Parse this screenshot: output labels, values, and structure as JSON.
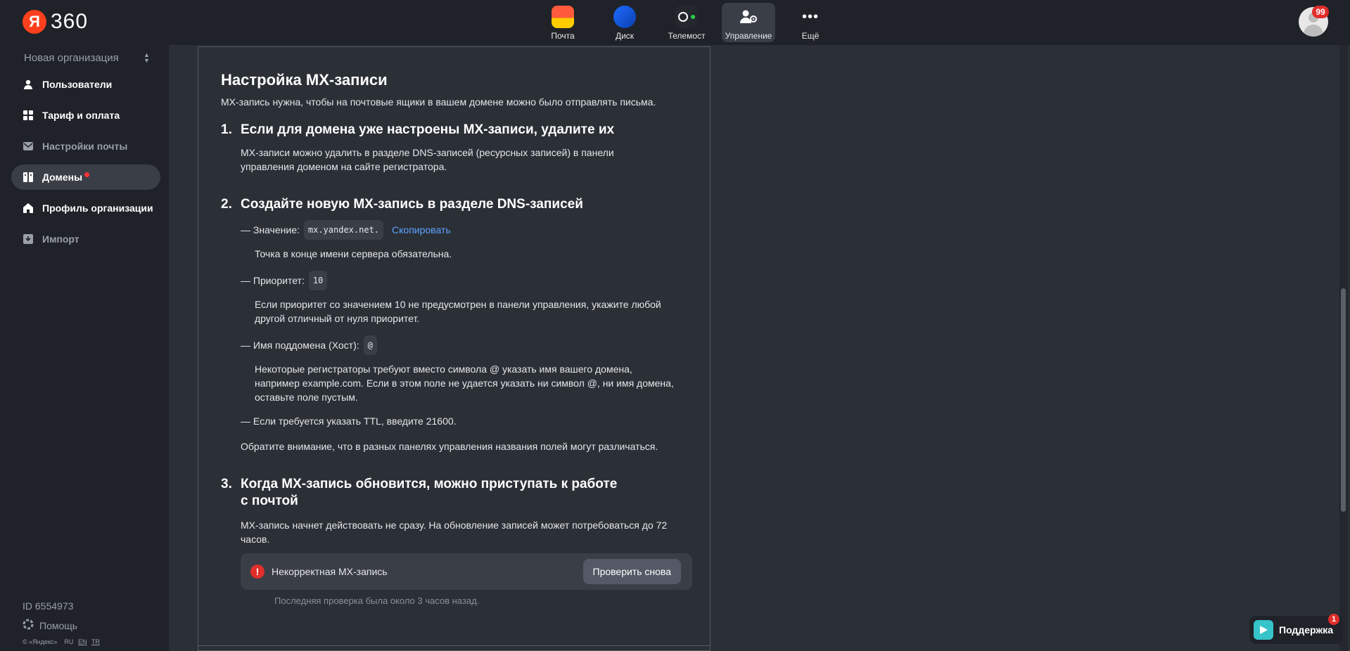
{
  "header": {
    "logo_letter": "Я",
    "logo_text": "360",
    "apps": [
      {
        "label": "Почта",
        "icon": "mail-icon"
      },
      {
        "label": "Диск",
        "icon": "disk-icon"
      },
      {
        "label": "Телемост",
        "icon": "telemost-icon"
      },
      {
        "label": "Управление",
        "icon": "admin-icon",
        "active": true
      },
      {
        "label": "Ещё",
        "icon": "more-icon"
      }
    ],
    "avatar_badge": "99"
  },
  "sidebar": {
    "org_name": "Новая организация",
    "items": [
      {
        "label": "Пользователи",
        "icon": "user-icon"
      },
      {
        "label": "Тариф и оплата",
        "icon": "grid-icon"
      },
      {
        "label": "Настройки почты",
        "icon": "mail-settings-icon"
      },
      {
        "label": "Домены",
        "icon": "domains-icon",
        "active": true
      },
      {
        "label": "Профиль организации",
        "icon": "home-icon"
      },
      {
        "label": "Импорт",
        "icon": "import-icon"
      }
    ],
    "id_text": "ID 6554973",
    "help_label": "Помощь",
    "copyright": "© «Яндекс»",
    "langs": [
      "RU",
      "EN",
      "TR"
    ]
  },
  "main": {
    "title": "Настройка MX-записи",
    "lead": "MX-запись нужна, чтобы на почтовые ящики в вашем домене можно было отправлять письма.",
    "step1": {
      "num": "1.",
      "title": "Если для домена уже настроены MX-записи, удалите их",
      "text": "MX-записи можно удалить в разделе DNS-записей (ресурсных записей) в панели управления доменом на сайте регистратора."
    },
    "step2": {
      "num": "2.",
      "title": "Создайте новую MX-запись в разделе DNS-записей",
      "value_label": "— Значение:",
      "value_code": "mx.yandex.net.",
      "copy_link": "Скопировать",
      "value_note": "Точка в конце имени сервера обязательна.",
      "priority_label": "— Приоритет:",
      "priority_code": "10",
      "priority_note": "Если приоритет со значением 10 не предусмотрен в панели управления, укажите любой другой отличный от нуля приоритет.",
      "host_label": "— Имя поддомена (Хост):",
      "host_code": "@",
      "host_note": "Некоторые регистраторы требуют вместо символа @ указать имя вашего домена, например example.com. Если в этом поле не удается указать ни символ @, ни имя домена, оставьте поле пустым.",
      "ttl_text": "— Если требуется указать TTL, введите 21600.",
      "footer_note": "Обратите внимание, что в разных панелях управления названия полей могут различаться."
    },
    "step3": {
      "num": "3.",
      "title_line1": "Когда MX-запись обновится, можно приступать к работе",
      "title_line2": "с почтой",
      "text": "MX-запись начнет действовать не сразу. На обновление записей может потребоваться до 72 часов.",
      "status_text": "Некорректная MX-запись",
      "recheck_button": "Проверить снова",
      "last_check": "Последняя проверка была около 3 часов назад."
    }
  },
  "support": {
    "label": "Поддержка",
    "badge": "1"
  }
}
